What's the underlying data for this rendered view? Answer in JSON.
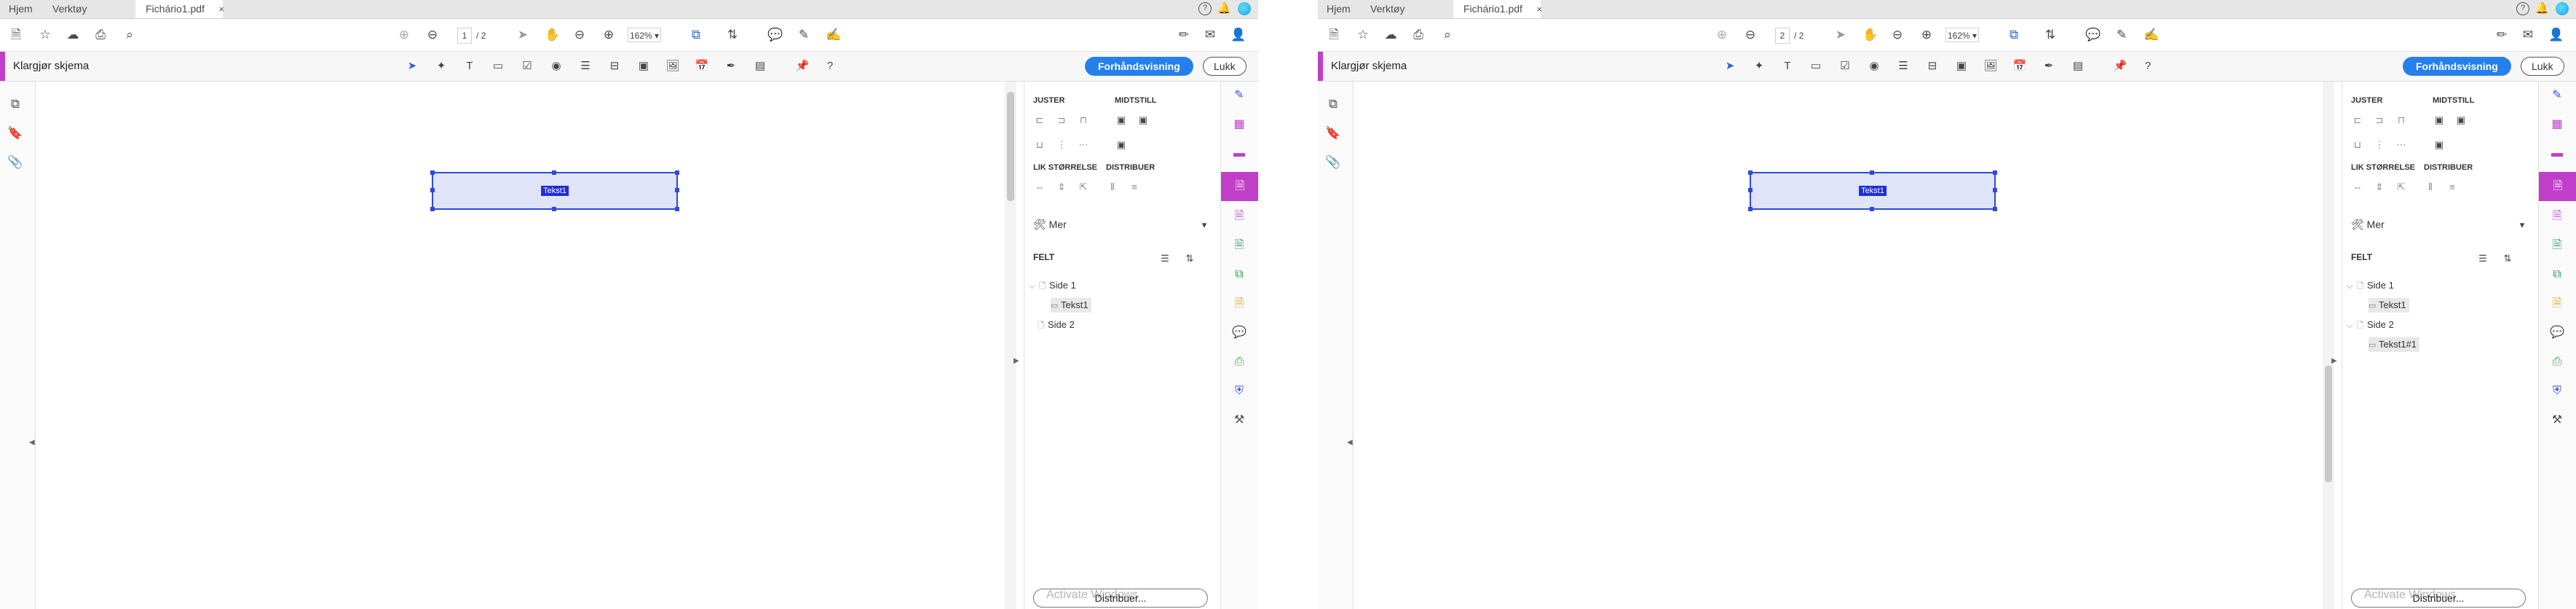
{
  "screens": [
    {
      "tabs": {
        "home": "Hjem",
        "tools": "Verktøy",
        "doc": "Fichário1.pdf",
        "close": "×"
      },
      "page": {
        "current": "1",
        "separator": "/",
        "total": "2"
      },
      "zoom": "162%",
      "form": {
        "title": "Klargjør skjema",
        "preview": "Forhåndsvisning",
        "close": "Lukk"
      },
      "field_label": "Tekst1",
      "pane": {
        "align": "JUSTER",
        "center": "MIDTSTILL",
        "size": "LIK STØRRELSE",
        "distribute": "DISTRIBUER",
        "more": "Mer",
        "fields": "FELT",
        "tree": [
          {
            "label": "Side 1",
            "expanded": true,
            "children": [
              "Tekst1"
            ]
          },
          {
            "label": "Side 2",
            "expanded": false,
            "children": []
          }
        ],
        "distribute_button": "Distribuer...",
        "watermark": "Activate Windows"
      }
    },
    {
      "tabs": {
        "home": "Hjem",
        "tools": "Verktøy",
        "doc": "Fichário1.pdf",
        "close": "×"
      },
      "page": {
        "current": "2",
        "separator": "/",
        "total": "2"
      },
      "zoom": "162%",
      "form": {
        "title": "Klargjør skjema",
        "preview": "Forhåndsvisning",
        "close": "Lukk"
      },
      "field_label": "Tekst1",
      "pane": {
        "align": "JUSTER",
        "center": "MIDTSTILL",
        "size": "LIK STØRRELSE",
        "distribute": "DISTRIBUER",
        "more": "Mer",
        "fields": "FELT",
        "tree": [
          {
            "label": "Side 1",
            "expanded": true,
            "children": [
              "Tekst1"
            ]
          },
          {
            "label": "Side 2",
            "expanded": true,
            "children": [
              "Tekst1#1"
            ]
          }
        ],
        "distribute_button": "Distribuer...",
        "watermark": "Activate Windows"
      }
    }
  ],
  "colors": {
    "accent": "#c03fc8",
    "primary": "#2680eb",
    "field_border": "#3049d8",
    "field_fill": "#dfe4f8"
  }
}
